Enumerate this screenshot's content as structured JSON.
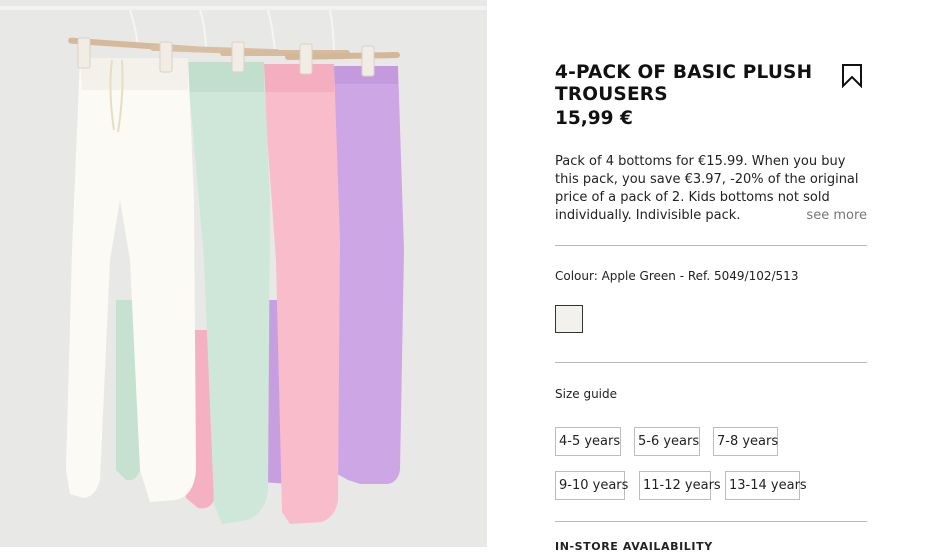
{
  "product": {
    "title": "4-PACK OF BASIC PLUSH TROUSERS",
    "price": "15,99 €",
    "description": "Pack of 4 bottoms for €15.99. When you buy this pack, you save €3.97, -20% of the original price of a pack of 2. Kids bottoms not sold individually. Indivisible pack.",
    "see_more": "see more",
    "colour_line": "Colour: Apple Green - Ref. 5049/102/513",
    "swatch": {
      "color": "#f3f1ee"
    },
    "size_guide": "Size guide",
    "sizes": [
      "4-5 years",
      "5-6 years",
      "7-8 years",
      "9-10 years",
      "11-12 years",
      "13-14 years"
    ],
    "store_availability": "IN-STORE AVAILABILITY"
  },
  "image": {
    "garment_colors": [
      "#fbfaf5",
      "#cfe7d8",
      "#f8bccb",
      "#cda6e6"
    ],
    "background_color": "#e8e8e6"
  },
  "icons": {
    "bookmark": "bookmark-icon"
  }
}
